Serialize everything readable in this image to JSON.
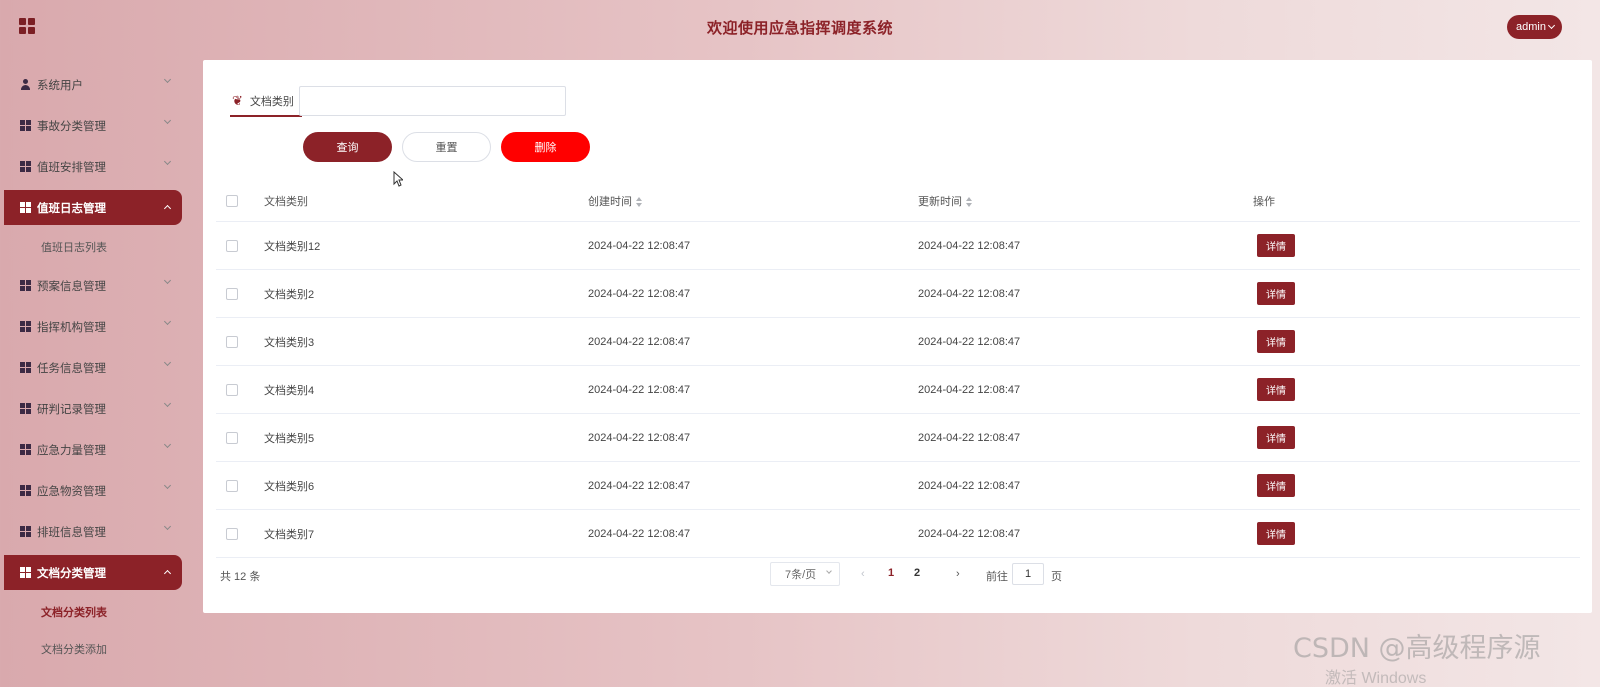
{
  "header": {
    "title": "欢迎使用应急指挥调度系统",
    "user": "admin"
  },
  "sidebar": {
    "items": [
      {
        "label": "系统用户",
        "icon": "user-icon",
        "active": false
      },
      {
        "label": "事故分类管理",
        "icon": "grid-icon",
        "active": false
      },
      {
        "label": "值班安排管理",
        "icon": "grid-icon",
        "active": false
      },
      {
        "label": "值班日志管理",
        "icon": "grid-icon",
        "active": true,
        "children": [
          "值班日志列表"
        ]
      },
      {
        "label": "预案信息管理",
        "icon": "grid-icon",
        "active": false
      },
      {
        "label": "指挥机构管理",
        "icon": "grid-icon",
        "active": false
      },
      {
        "label": "任务信息管理",
        "icon": "grid-icon",
        "active": false
      },
      {
        "label": "研判记录管理",
        "icon": "grid-icon",
        "active": false
      },
      {
        "label": "应急力量管理",
        "icon": "grid-icon",
        "active": false
      },
      {
        "label": "应急物资管理",
        "icon": "grid-icon",
        "active": false
      },
      {
        "label": "排班信息管理",
        "icon": "grid-icon",
        "active": false
      },
      {
        "label": "文档分类管理",
        "icon": "grid-icon",
        "active": true,
        "children": [
          "文档分类列表",
          "文档分类添加"
        ]
      }
    ]
  },
  "filter": {
    "label": "文档类别",
    "value": ""
  },
  "buttons": {
    "search": "查询",
    "reset": "重置",
    "delete": "删除"
  },
  "table": {
    "headers": {
      "name": "文档类别",
      "created": "创建时间",
      "updated": "更新时间",
      "op": "操作"
    },
    "rows": [
      {
        "name": "文档类别12",
        "created": "2024-04-22 12:08:47",
        "updated": "2024-04-22 12:08:47",
        "action": "详情"
      },
      {
        "name": "文档类别2",
        "created": "2024-04-22 12:08:47",
        "updated": "2024-04-22 12:08:47",
        "action": "详情"
      },
      {
        "name": "文档类别3",
        "created": "2024-04-22 12:08:47",
        "updated": "2024-04-22 12:08:47",
        "action": "详情"
      },
      {
        "name": "文档类别4",
        "created": "2024-04-22 12:08:47",
        "updated": "2024-04-22 12:08:47",
        "action": "详情"
      },
      {
        "name": "文档类别5",
        "created": "2024-04-22 12:08:47",
        "updated": "2024-04-22 12:08:47",
        "action": "详情"
      },
      {
        "name": "文档类别6",
        "created": "2024-04-22 12:08:47",
        "updated": "2024-04-22 12:08:47",
        "action": "详情"
      },
      {
        "name": "文档类别7",
        "created": "2024-04-22 12:08:47",
        "updated": "2024-04-22 12:08:47",
        "action": "详情"
      }
    ]
  },
  "pagination": {
    "total": "共 12 条",
    "page_size": "7条/页",
    "pages": [
      "1",
      "2"
    ],
    "current": "1",
    "goto_label": "前往",
    "goto_value": "1",
    "goto_unit": "页"
  },
  "watermark": {
    "text": "CSDN @高级程序源",
    "activate": "激活 Windows"
  },
  "colors": {
    "primary": "#8c2228",
    "danger": "#ff0000"
  }
}
